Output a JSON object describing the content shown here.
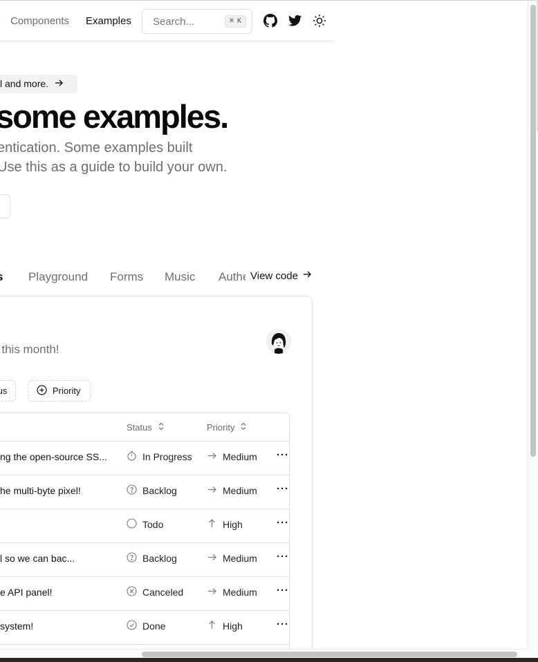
{
  "nav": {
    "links": [
      "Components",
      "Examples"
    ],
    "search_placeholder": "Search...",
    "search_shortcut": [
      "⌘",
      "K"
    ],
    "icons": [
      "github-icon",
      "twitter-icon",
      "sun-icon"
    ]
  },
  "hero": {
    "announcement": "l and more.",
    "title": "some examples.",
    "subtitle_line1": "entication. Some examples built",
    "subtitle_line2": "Use this as a guide to build your own."
  },
  "tabs": {
    "items": [
      "s",
      "Playground",
      "Forms",
      "Music",
      "Authe"
    ],
    "view_code": "View code"
  },
  "card": {
    "subtitle": "r this month!",
    "filters": [
      "tus",
      "Priority"
    ]
  },
  "table": {
    "headers": {
      "status": "Status",
      "priority": "Priority"
    },
    "rows": [
      {
        "title": "ng the open-source SS...",
        "status": "In Progress",
        "status_icon": "stopwatch-icon",
        "priority": "Medium",
        "priority_icon": "arrow-right-icon"
      },
      {
        "title": "he multi-byte pixel!",
        "status": "Backlog",
        "status_icon": "question-circle-icon",
        "priority": "Medium",
        "priority_icon": "arrow-right-icon"
      },
      {
        "title": "",
        "status": "Todo",
        "status_icon": "circle-icon",
        "priority": "High",
        "priority_icon": "arrow-up-icon"
      },
      {
        "title": "l so we can bac...",
        "status": "Backlog",
        "status_icon": "question-circle-icon",
        "priority": "Medium",
        "priority_icon": "arrow-right-icon"
      },
      {
        "title": "e API panel!",
        "status": "Canceled",
        "status_icon": "cross-circle-icon",
        "priority": "Medium",
        "priority_icon": "arrow-right-icon"
      },
      {
        "title": "system!",
        "status": "Done",
        "status_icon": "check-circle-icon",
        "priority": "High",
        "priority_icon": "arrow-up-icon"
      }
    ],
    "more_glyph": "···"
  }
}
